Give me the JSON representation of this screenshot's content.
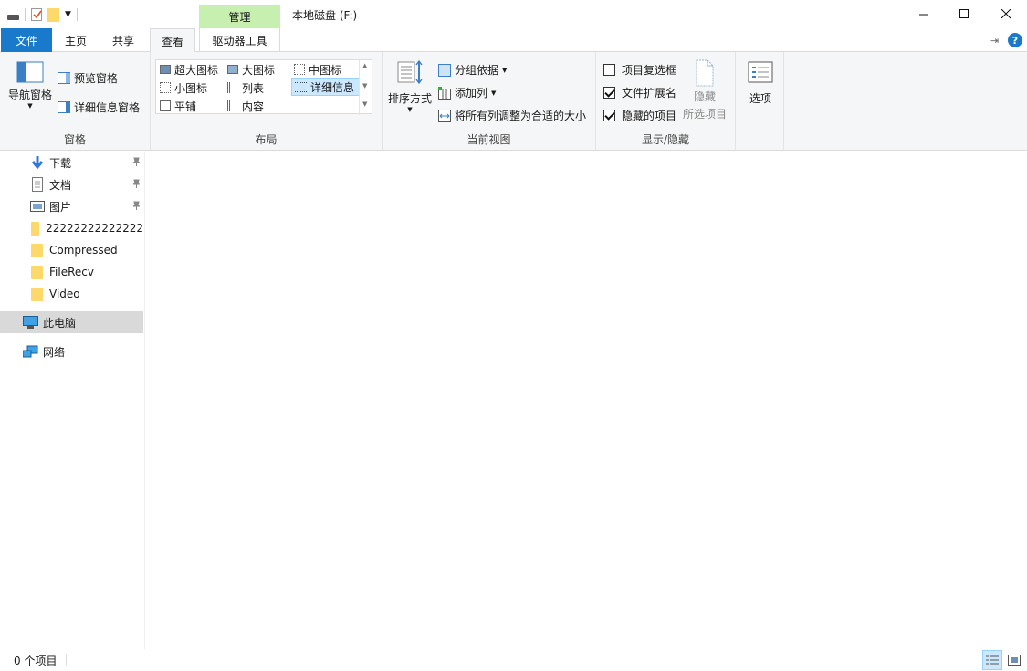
{
  "window": {
    "title": "本地磁盘 (F:)",
    "contextual_tab_header": "管理"
  },
  "tabs": [
    {
      "label": "文件"
    },
    {
      "label": "主页"
    },
    {
      "label": "共享"
    },
    {
      "label": "查看"
    },
    {
      "label": "驱动器工具"
    }
  ],
  "ribbon": {
    "panes": {
      "label": "窗格",
      "nav_pane": "导航窗格",
      "preview_pane": "预览窗格",
      "details_pane": "详细信息窗格"
    },
    "layout": {
      "label": "布局",
      "items": [
        {
          "label": "超大图标"
        },
        {
          "label": "大图标"
        },
        {
          "label": "中图标"
        },
        {
          "label": "小图标"
        },
        {
          "label": "列表"
        },
        {
          "label": "详细信息"
        },
        {
          "label": "平铺"
        },
        {
          "label": "内容"
        }
      ],
      "selected": "详细信息"
    },
    "current_view": {
      "label": "当前视图",
      "sort_by": "排序方式",
      "group_by": "分组依据",
      "add_columns": "添加列",
      "fit_columns": "将所有列调整为合适的大小"
    },
    "show_hide": {
      "label": "显示/隐藏",
      "item_checkboxes": {
        "label": "项目复选框",
        "checked": false
      },
      "file_extensions": {
        "label": "文件扩展名",
        "checked": true
      },
      "hidden_items": {
        "label": "隐藏的项目",
        "checked": true
      },
      "hide_selected": "隐藏",
      "hide_selected_line2": "所选项目"
    },
    "options": {
      "label": "选项"
    }
  },
  "nav": {
    "items": [
      {
        "label": "下载",
        "pinned": true,
        "icon": "download-icon"
      },
      {
        "label": "文档",
        "pinned": true,
        "icon": "document-icon"
      },
      {
        "label": "图片",
        "pinned": true,
        "icon": "picture-icon"
      },
      {
        "label": "22222222222222",
        "pinned": false,
        "icon": "folder-icon"
      },
      {
        "label": "Compressed",
        "pinned": false,
        "icon": "folder-icon"
      },
      {
        "label": "FileRecv",
        "pinned": false,
        "icon": "folder-icon"
      },
      {
        "label": "Video",
        "pinned": false,
        "icon": "folder-icon"
      },
      {
        "label": "此电脑",
        "selected": true,
        "icon": "computer-icon"
      },
      {
        "label": "网络",
        "icon": "network-icon"
      }
    ]
  },
  "status": {
    "item_count": "0 个项目"
  },
  "colors": {
    "accent": "#1979ca",
    "manage_tab": "#c6efb0",
    "folder": "#ffd86b"
  }
}
